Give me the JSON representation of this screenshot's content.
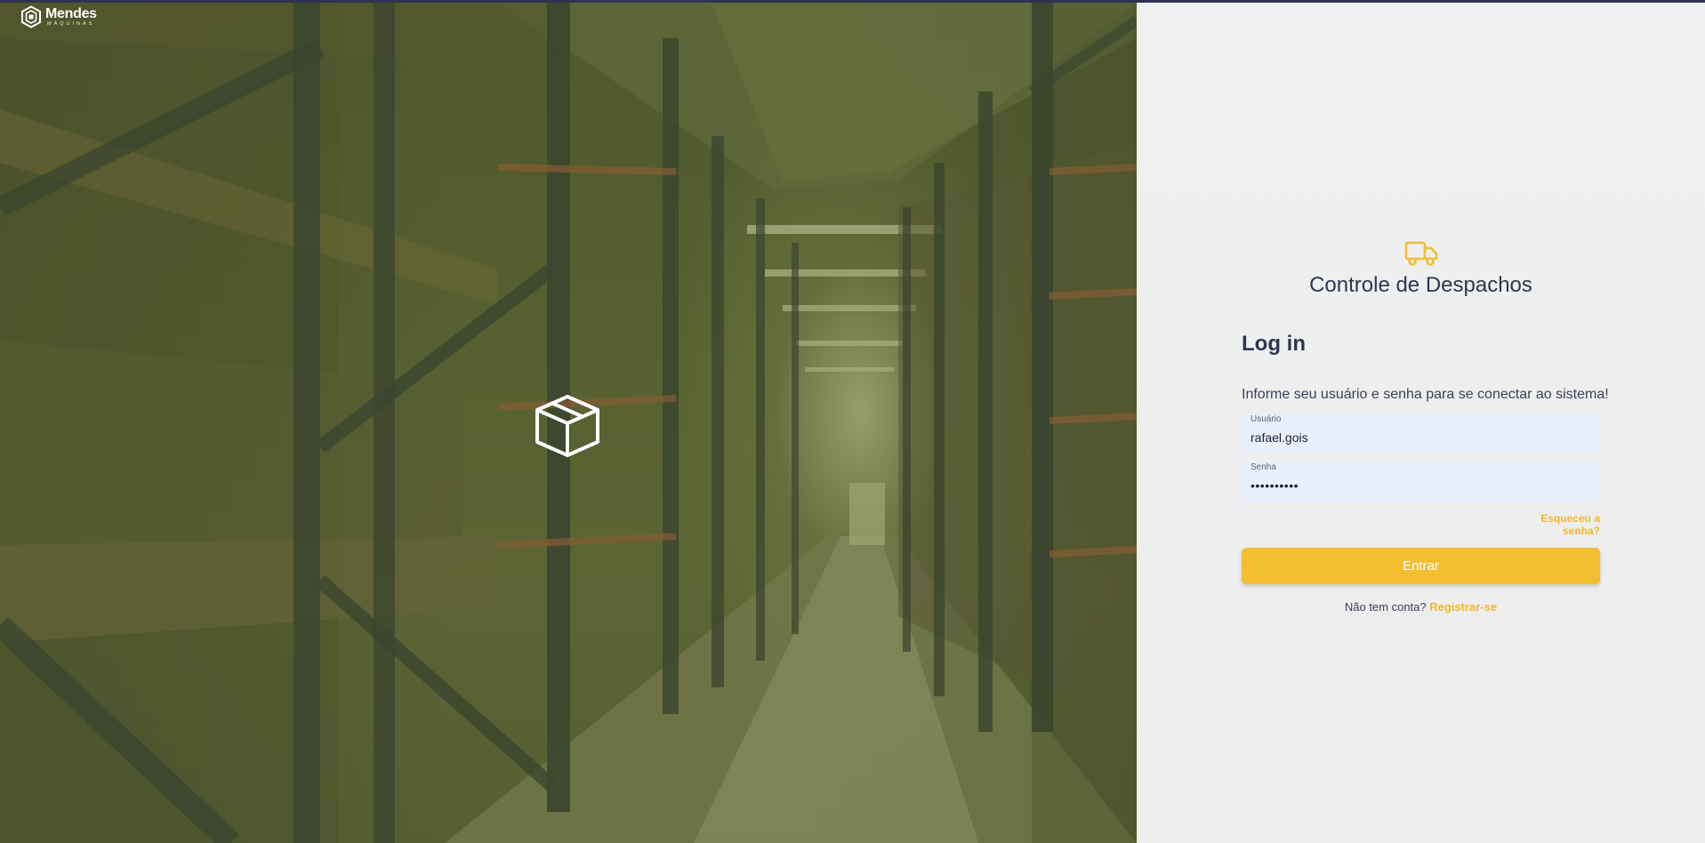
{
  "brand": {
    "name": "Mendes",
    "sub": "MÁQUINAS"
  },
  "hero": {
    "icon": "box-icon"
  },
  "login": {
    "app_icon": "truck-icon",
    "app_title": "Controle de Despachos",
    "heading": "Log in",
    "instruction": "Informe seu usuário e senha para se conectar ao sistema!",
    "username": {
      "label": "Usuário",
      "value": "rafael.gois"
    },
    "password": {
      "label": "Senha",
      "value": "rafaelgois"
    },
    "forgot_label": "Esqueceu a senha?",
    "submit_label": "Entrar",
    "register_prompt": "Não tem conta?",
    "register_label": "Registrar-se"
  },
  "colors": {
    "accent": "#f4be32",
    "title": "#2f3650",
    "field_bg": "#e8f0fe",
    "panel_bg": "#eeeeee"
  }
}
